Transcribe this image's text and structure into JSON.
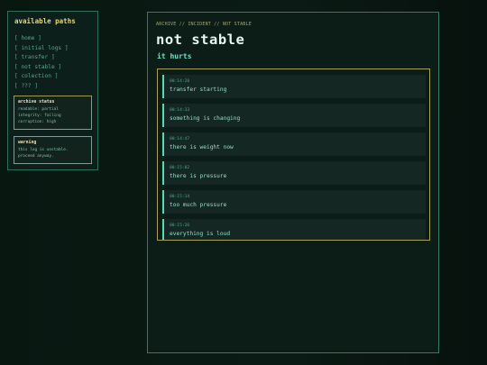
{
  "sidebar": {
    "title": "available paths",
    "items": [
      {
        "label": "[ home ]"
      },
      {
        "label": "[ initial logs ]"
      },
      {
        "label": "[ transfer ]"
      },
      {
        "label": "[ not stable ]"
      },
      {
        "label": "[ colection ]"
      },
      {
        "label": "[ ??? ]"
      }
    ],
    "archive_status": {
      "title": "archive status",
      "lines": [
        "readable: partial",
        "integrity: failing",
        "corruption: high"
      ]
    },
    "warning": {
      "title": "warning",
      "lines": [
        "this log is unstable.",
        "proceed anyway."
      ]
    }
  },
  "main": {
    "breadcrumb": "ARCHIVE // INCIDENT // NOT STABLE",
    "title": "not stable",
    "subtitle": "it hurts",
    "log_entries": [
      {
        "time": "00:14:20",
        "text": "transfer starting"
      },
      {
        "time": "00:14:33",
        "text": "something is changing"
      },
      {
        "time": "00:14:47",
        "text": "there is weight now"
      },
      {
        "time": "00:15:02",
        "text": "there is pressure"
      },
      {
        "time": "00:15:14",
        "text": "too much pressure"
      },
      {
        "time": "00:15:26",
        "text": "everything is loud"
      }
    ]
  },
  "colors": {
    "accent": "#56d8bb",
    "title_yellow": "#e8d77a",
    "border_yellow": "#a89f56",
    "panel_border": "#2f7c67"
  }
}
